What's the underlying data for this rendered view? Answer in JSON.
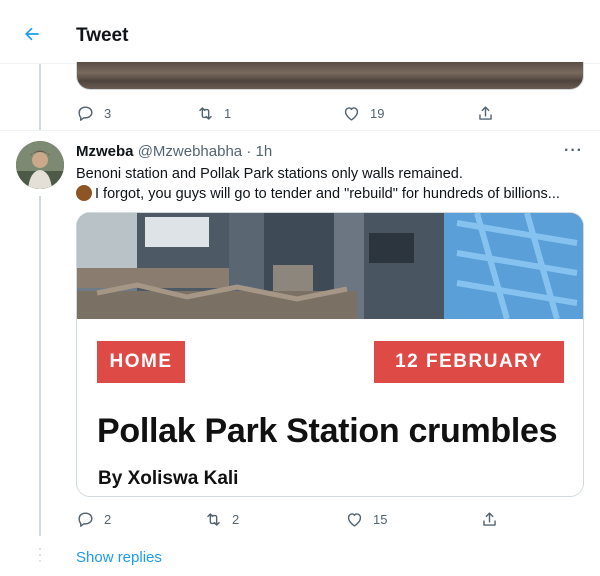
{
  "header": {
    "title": "Tweet",
    "back_icon": "arrow-left-icon"
  },
  "previous_tweet": {
    "actions": {
      "replies": "3",
      "retweets": "1",
      "likes": "19"
    }
  },
  "tweet": {
    "author_name": "Mzweba",
    "handle": "@Mzwebhabha",
    "separator": "·",
    "time": "1h",
    "more": "···",
    "text_line1": "Benoni station and Pollak Park stations only walls remained.",
    "text_line2": "I forgot, you guys will go to tender and \"rebuild\" for hundreds of billions...",
    "card": {
      "tag_left": "HOME",
      "tag_right": "12 FEBRUARY",
      "headline": "Pollak Park Station crumbles",
      "byline": "By Xoliswa Kali"
    },
    "actions": {
      "replies": "2",
      "retweets": "2",
      "likes": "15"
    }
  },
  "footer": {
    "show_replies": "Show replies"
  },
  "colors": {
    "accent": "#1d9bf0",
    "tag": "#de4a45",
    "muted": "#536471"
  }
}
